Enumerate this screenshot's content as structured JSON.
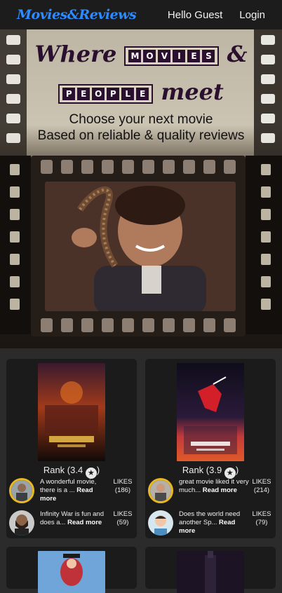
{
  "nav": {
    "brand": "Movies&Reviews",
    "greeting": "Hello Guest",
    "login": "Login"
  },
  "hero": {
    "line1_word": "Where",
    "line1_boxed": [
      "M",
      "O",
      "V",
      "I",
      "E",
      "S"
    ],
    "line1_amp": "&",
    "line2_boxed": [
      "P",
      "E",
      "O",
      "P",
      "L",
      "E"
    ],
    "line2_word": "meet",
    "subtitle_1": "Choose your next movie",
    "subtitle_2": "Based on reliable & quality reviews"
  },
  "cards": [
    {
      "rank_label": "Rank (3.4",
      "rank_close": ")",
      "reviews": [
        {
          "text": "A wonderful movie, there is a ...",
          "more": "Read more",
          "likes_label": "LIKES",
          "likes": "(186)"
        },
        {
          "text": "Infinity War is fun and does a...",
          "more": "Read more",
          "likes_label": "LIKES",
          "likes": "(59)"
        }
      ]
    },
    {
      "rank_label": "Rank (3.9",
      "rank_close": ")",
      "reviews": [
        {
          "text": "great movie liked it very much...",
          "more": "Read more",
          "likes_label": "LIKES",
          "likes": "(214)"
        },
        {
          "text": "Does the world need another Sp...",
          "more": "Read more",
          "likes_label": "LIKES",
          "likes": "(79)"
        }
      ]
    }
  ],
  "colors": {
    "brand": "#2e8bff",
    "card_bg": "#1b1b1b",
    "avatar_ring": "#e8b920",
    "page_bg": "#2b2b2b"
  },
  "icons": {
    "star": "star-icon"
  }
}
